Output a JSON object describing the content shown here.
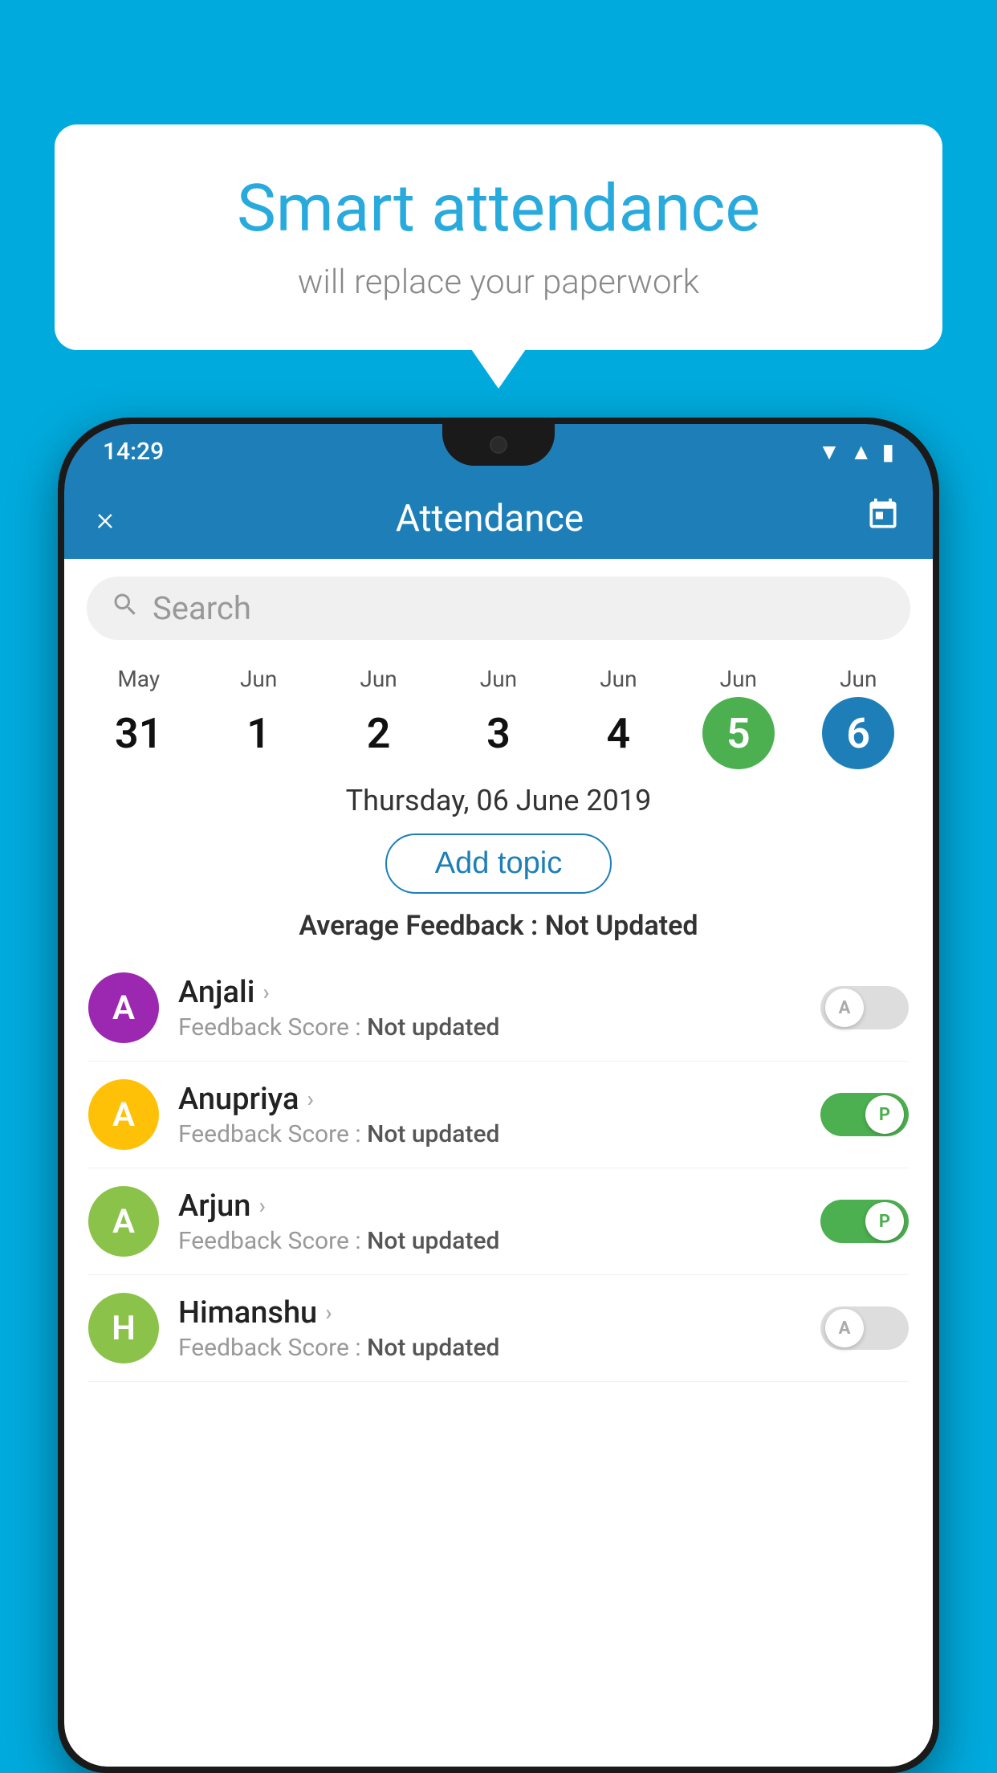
{
  "background_color": "#00AADD",
  "bubble": {
    "title": "Smart attendance",
    "subtitle": "will replace your paperwork"
  },
  "phone": {
    "status_bar": {
      "time": "14:29",
      "icons": [
        "wifi",
        "signal",
        "battery"
      ]
    },
    "header": {
      "title": "Attendance",
      "close_label": "×",
      "calendar_label": "📅"
    },
    "search": {
      "placeholder": "Search"
    },
    "calendar": {
      "days": [
        {
          "month": "May",
          "date": "31",
          "state": "normal"
        },
        {
          "month": "Jun",
          "date": "1",
          "state": "normal"
        },
        {
          "month": "Jun",
          "date": "2",
          "state": "normal"
        },
        {
          "month": "Jun",
          "date": "3",
          "state": "normal"
        },
        {
          "month": "Jun",
          "date": "4",
          "state": "normal"
        },
        {
          "month": "Jun",
          "date": "5",
          "state": "today"
        },
        {
          "month": "Jun",
          "date": "6",
          "state": "selected"
        }
      ]
    },
    "selected_date": "Thursday, 06 June 2019",
    "add_topic_label": "Add topic",
    "avg_feedback_label": "Average Feedback :",
    "avg_feedback_value": "Not Updated",
    "students": [
      {
        "name": "Anjali",
        "avatar_letter": "A",
        "avatar_color": "#9C27B0",
        "feedback_label": "Feedback Score :",
        "feedback_value": "Not updated",
        "toggle_state": "off",
        "toggle_letter": "A"
      },
      {
        "name": "Anupriya",
        "avatar_letter": "A",
        "avatar_color": "#FFC107",
        "feedback_label": "Feedback Score :",
        "feedback_value": "Not updated",
        "toggle_state": "on",
        "toggle_letter": "P"
      },
      {
        "name": "Arjun",
        "avatar_letter": "A",
        "avatar_color": "#8BC34A",
        "feedback_label": "Feedback Score :",
        "feedback_value": "Not updated",
        "toggle_state": "on",
        "toggle_letter": "P"
      },
      {
        "name": "Himanshu",
        "avatar_letter": "H",
        "avatar_color": "#8BC34A",
        "feedback_label": "Feedback Score :",
        "feedback_value": "Not updated",
        "toggle_state": "off",
        "toggle_letter": "A"
      }
    ]
  }
}
